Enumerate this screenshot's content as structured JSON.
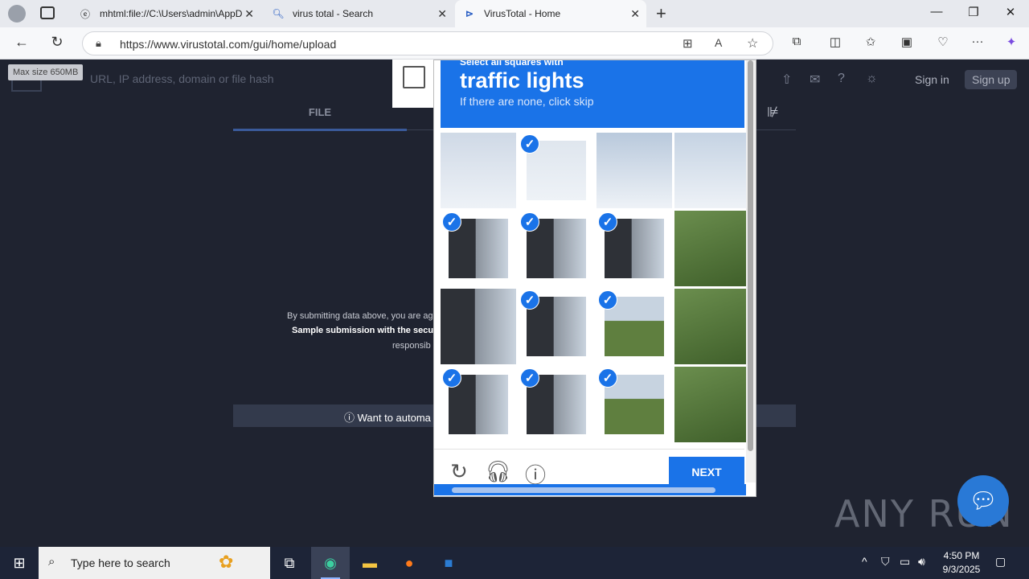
{
  "browser": {
    "tabs": [
      {
        "label": "mhtml:file://C:\\Users\\admin\\AppD",
        "icon": "ie-icon"
      },
      {
        "label": "virus total - Search",
        "icon": "search-icon"
      },
      {
        "label": "VirusTotal - Home",
        "icon": "virustotal-icon"
      }
    ],
    "url": "https://www.virustotal.com/gui/home/upload"
  },
  "vt": {
    "max_size": "Max size 650MB",
    "search_placeholder": "URL, IP address, domain or file hash",
    "sign_in": "Sign in",
    "sign_up": "Sign up",
    "tab_file": "FILE",
    "submit_text_1": "By submitting data above, you are ag",
    "submit_text_2": "Sample submission with the secu",
    "submit_text_3": "responsib",
    "automate_text": "ⓘ Want to automa"
  },
  "captcha": {
    "line1": "Select all squares with",
    "line2": "traffic lights",
    "line3": "If there are none, click skip",
    "next_label": "NEXT",
    "check_glyph": "✓",
    "cells_selected": [
      false,
      true,
      false,
      false,
      true,
      true,
      true,
      false,
      false,
      true,
      true,
      false,
      true,
      true,
      true,
      false
    ]
  },
  "watermark": "ANY RUN",
  "taskbar": {
    "search_placeholder": "Type here to search",
    "time": "4:50 PM",
    "date": "9/3/2025"
  }
}
